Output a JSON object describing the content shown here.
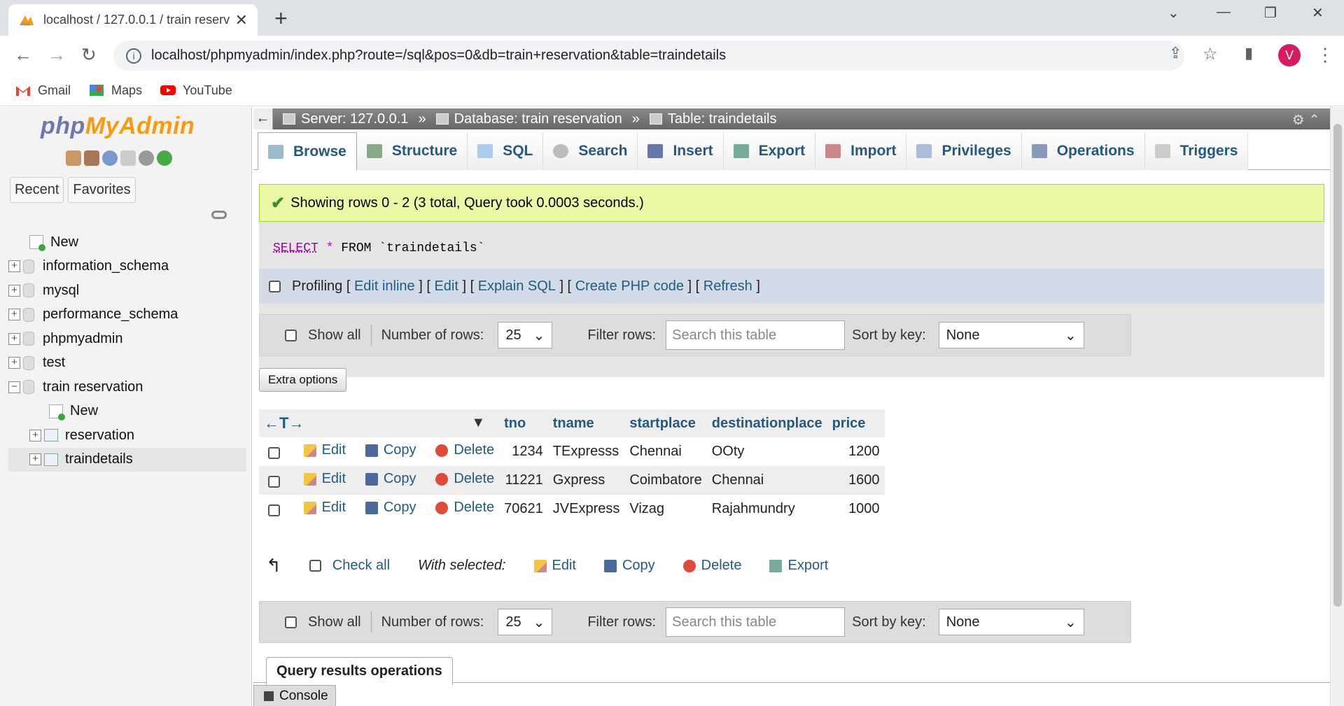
{
  "browser": {
    "tab_title": "localhost / 127.0.0.1 / train reserv",
    "url": "localhost/phpmyadmin/index.php?route=/sql&pos=0&db=train+reservation&table=traindetails",
    "profile_initial": "V",
    "bookmarks": [
      "Gmail",
      "Maps",
      "YouTube"
    ]
  },
  "nav": {
    "logo_php": "php",
    "logo_myadmin": "MyAdmin",
    "tabs": [
      "Recent",
      "Favorites"
    ],
    "tree": [
      {
        "label": "New"
      },
      {
        "label": "information_schema"
      },
      {
        "label": "mysql"
      },
      {
        "label": "performance_schema"
      },
      {
        "label": "phpmyadmin"
      },
      {
        "label": "test"
      },
      {
        "label": "train reservation"
      },
      {
        "label": "New"
      },
      {
        "label": "reservation"
      },
      {
        "label": "traindetails"
      }
    ]
  },
  "breadcrumb": {
    "server": "Server: 127.0.0.1",
    "database": "Database: train reservation",
    "table": "Table: traindetails",
    "sep": "»"
  },
  "tabs": [
    "Browse",
    "Structure",
    "SQL",
    "Search",
    "Insert",
    "Export",
    "Import",
    "Privileges",
    "Operations",
    "Triggers"
  ],
  "message": "Showing rows 0 - 2 (3 total, Query took 0.0003 seconds.)",
  "sql": {
    "select": "SELECT",
    "star": "*",
    "from": "FROM",
    "table": "`traindetails`"
  },
  "profiling": {
    "label": "Profiling",
    "links": [
      "Edit inline",
      "Edit",
      "Explain SQL",
      "Create PHP code",
      "Refresh"
    ]
  },
  "navbar": {
    "show_all": "Show all",
    "num_rows_label": "Number of rows:",
    "num_rows_value": "25",
    "filter_label": "Filter rows:",
    "filter_placeholder": "Search this table",
    "sort_label": "Sort by key:",
    "sort_value": "None"
  },
  "extra_options": "Extra options",
  "table": {
    "columns": [
      "tno",
      "tname",
      "startplace",
      "destinationplace",
      "price"
    ],
    "actions": {
      "edit": "Edit",
      "copy": "Copy",
      "delete": "Delete"
    },
    "rows": [
      [
        "1234",
        "TExpresss",
        "Chennai",
        "OOty",
        "1200"
      ],
      [
        "11221",
        "Gxpress",
        "Coimbatore",
        "Chennai",
        "1600"
      ],
      [
        "70621",
        "JVExpress",
        "Vizag",
        "Rajahmundry",
        "1000"
      ]
    ]
  },
  "with_selected": {
    "check_all": "Check all",
    "label": "With selected:",
    "edit": "Edit",
    "copy": "Copy",
    "delete": "Delete",
    "export": "Export"
  },
  "query_results_ops": "Query results operations",
  "console": "Console"
}
